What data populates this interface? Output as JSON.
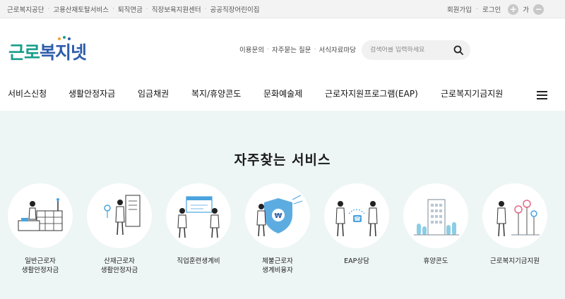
{
  "topbar": {
    "links": [
      "근로복지공단",
      "고용산재토탈서비스",
      "퇴직연금",
      "직장보육지원센터",
      "공공직장어린이집"
    ],
    "join": "회원가입",
    "login": "로그인",
    "font_plus": "+",
    "font_label": "가",
    "font_minus": "−"
  },
  "header": {
    "logo_part1": "근로",
    "logo_part2": "복지넷",
    "quick_links": [
      "이용문의",
      "자주묻는 질문",
      "서식자료마당"
    ],
    "search_placeholder": "검색어를 입력하세요"
  },
  "nav": {
    "items": [
      "서비스신청",
      "생활안정자금",
      "임금채권",
      "복지/휴양콘도",
      "문화예술제",
      "근로자지원프로그램(EAP)",
      "근로복지기금지원"
    ]
  },
  "services": {
    "title": "자주찾는 서비스",
    "items": [
      {
        "line1": "일반근로자",
        "line2": "생활안정자금"
      },
      {
        "line1": "산재근로자",
        "line2": "생활안정자금"
      },
      {
        "line1": "직업훈련생계비",
        "line2": ""
      },
      {
        "line1": "체불근로자",
        "line2": "생계비융자"
      },
      {
        "line1": "EAP상담",
        "line2": ""
      },
      {
        "line1": "휴양콘도",
        "line2": ""
      },
      {
        "line1": "근로복지기금지원",
        "line2": ""
      }
    ]
  },
  "colors": {
    "brand_teal": "#1a9f8c",
    "brand_blue": "#2f5dab",
    "section_bg": "#eef5f5",
    "illustration_accent": "#4aa3df"
  },
  "icons": [
    "plus-icon",
    "minus-icon",
    "search-icon",
    "hamburger-icon"
  ]
}
